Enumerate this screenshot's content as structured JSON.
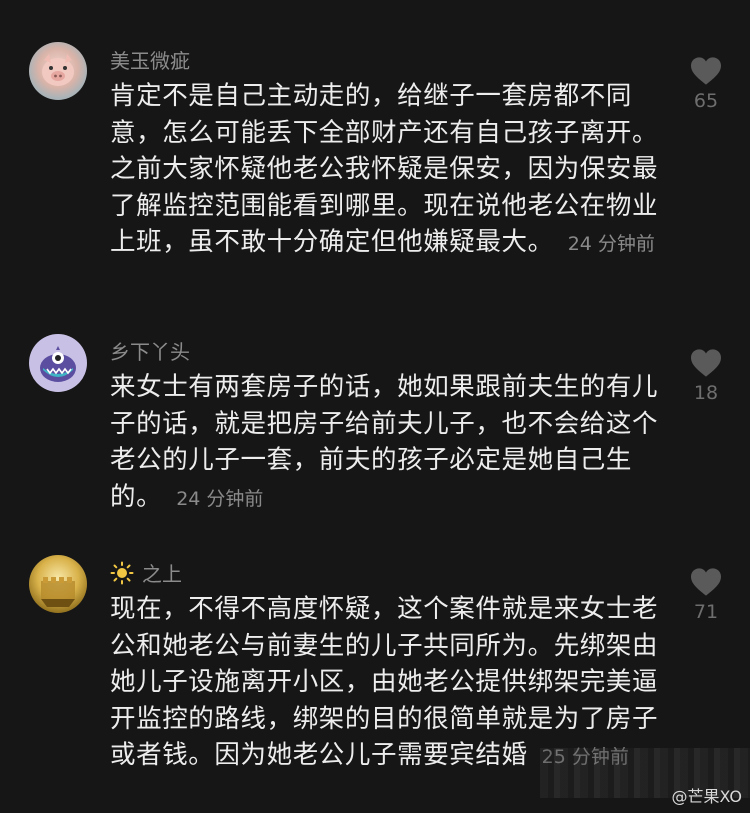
{
  "comments": [
    {
      "username": "美玉微疵",
      "text": "肯定不是自己主动走的，给继子一套房都不同意，怎么可能丢下全部财产还有自己孩子离开。之前大家怀疑他老公我怀疑是保安，因为保安最了解监控范围能看到哪里。现在说他老公在物业上班，虽不敢十分确定但他嫌疑最大。",
      "time": "24 分钟前",
      "likes": "65",
      "avatar_icon": "cartoon-pig-avatar"
    },
    {
      "username": "乡下丫头",
      "text": "来女士有两套房子的话，她如果跟前夫生的有儿子的话，就是把房子给前夫儿子，也不会给这个老公的儿子一套，前夫的孩子必定是她自己生的。",
      "time": "24 分钟前",
      "likes": "18",
      "avatar_icon": "cartoon-monster-avatar"
    },
    {
      "username": "之上",
      "username_prefix_icon": "sun-icon",
      "text": "现在，不得不高度怀疑，这个案件就是来女士老公和她老公与前妻生的儿子共同所为。先绑架由她儿子设施离开小区，由她老公提供绑架完美逼开监控的路线，绑架的目的很简单就是为了房子或者钱。因为她老公儿子需要宾结婚",
      "time": "25 分钟前",
      "likes": "71",
      "avatar_icon": "golden-wall-avatar"
    }
  ],
  "watermark": "@芒果XO",
  "colors": {
    "background": "#161616",
    "text": "#ededed",
    "meta": "#8a8a8a",
    "like_icon": "#5a5a5a"
  }
}
